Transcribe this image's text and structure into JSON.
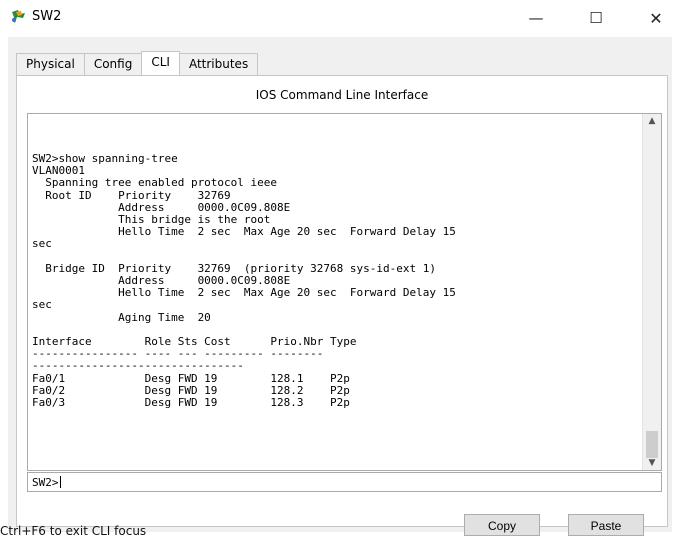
{
  "window": {
    "title": "SW2",
    "minimize_label": "—",
    "maximize_label": "☐",
    "close_label": "✕"
  },
  "tabs": [
    {
      "label": "Physical"
    },
    {
      "label": "Config"
    },
    {
      "label": "CLI"
    },
    {
      "label": "Attributes"
    }
  ],
  "active_tab": "CLI",
  "cli": {
    "header": "IOS Command Line Interface",
    "output": "SW2>show spanning-tree\nVLAN0001\n  Spanning tree enabled protocol ieee\n  Root ID    Priority    32769\n             Address     0000.0C09.808E\n             This bridge is the root\n             Hello Time  2 sec  Max Age 20 sec  Forward Delay 15\nsec\n\n  Bridge ID  Priority    32769  (priority 32768 sys-id-ext 1)\n             Address     0000.0C09.808E\n             Hello Time  2 sec  Max Age 20 sec  Forward Delay 15\nsec\n             Aging Time  20\n\nInterface        Role Sts Cost      Prio.Nbr Type\n---------------- ---- --- --------- --------\n--------------------------------\nFa0/1            Desg FWD 19        128.1    P2p\nFa0/2            Desg FWD 19        128.2    P2p\nFa0/3            Desg FWD 19        128.3    P2p",
    "prompt": "SW2>",
    "scroll_up_label": "▲",
    "scroll_down_label": "▼"
  },
  "footer": {
    "hint": "Ctrl+F6 to exit CLI focus",
    "copy_label": "Copy",
    "paste_label": "Paste"
  },
  "colors": {
    "background": "#ffffff",
    "frame": "#f0f0f0",
    "border": "#c6c6c6"
  },
  "icons": {
    "app": "packet-tracer-switch-icon"
  }
}
